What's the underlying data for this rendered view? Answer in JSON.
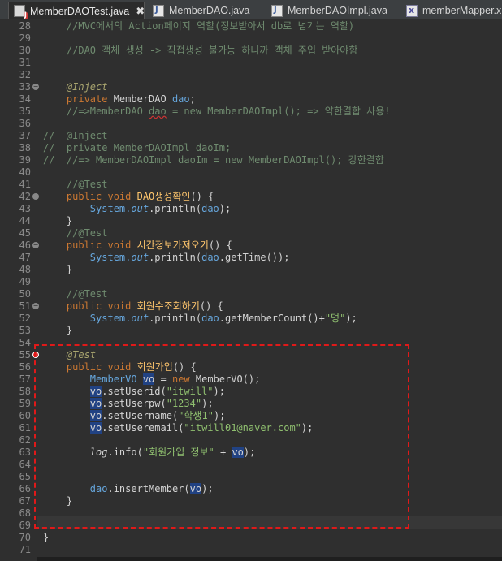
{
  "tabs": [
    {
      "label": "MemberDAOTest.java",
      "icon": "java-test-file-icon",
      "active": true,
      "close": "✖"
    },
    {
      "label": "MemberDAO.java",
      "icon": "java-file-icon",
      "active": false
    },
    {
      "label": "MemberDAOImpl.java",
      "icon": "java-file-icon",
      "active": false
    },
    {
      "label": "memberMapper.xm",
      "icon": "xml-file-icon",
      "active": false
    }
  ],
  "lines": [
    {
      "n": "28",
      "segs": [
        [
          "cm",
          "    //MVC에서의 Action페이지 역할(정보받아서 db로 넘기는 역할)"
        ]
      ]
    },
    {
      "n": "29",
      "segs": []
    },
    {
      "n": "30",
      "segs": [
        [
          "cm",
          "    //DAO 객체 생성 -> 직접생성 불가능 하니까 객체 주입 받아야함"
        ]
      ]
    },
    {
      "n": "31",
      "segs": []
    },
    {
      "n": "32",
      "segs": []
    },
    {
      "n": "33",
      "fold": true,
      "segs": [
        [
          "an",
          "    @Inject"
        ]
      ]
    },
    {
      "n": "34",
      "segs": [
        [
          "kw",
          "    private "
        ],
        [
          "txt",
          "MemberDAO "
        ],
        [
          "fld",
          "dao"
        ],
        [
          "txt",
          ";"
        ]
      ]
    },
    {
      "n": "35",
      "segs": [
        [
          "cm",
          "    //=>MemberDAO "
        ],
        [
          "cmsq",
          "dao"
        ],
        [
          "cm",
          " = new MemberDAOImpl(); => 약한결합 사용!"
        ]
      ]
    },
    {
      "n": "36",
      "segs": []
    },
    {
      "n": "37",
      "segs": [
        [
          "cm",
          "//  @Inject"
        ]
      ]
    },
    {
      "n": "38",
      "segs": [
        [
          "cm",
          "//  private MemberDAOImpl daoIm;"
        ]
      ]
    },
    {
      "n": "39",
      "segs": [
        [
          "cm",
          "//  //=> MemberDAOImpl daoIm = new MemberDAOImpl(); 강한결합"
        ]
      ]
    },
    {
      "n": "40",
      "segs": []
    },
    {
      "n": "41",
      "segs": [
        [
          "cm",
          "    //@Test"
        ]
      ]
    },
    {
      "n": "42",
      "fold": true,
      "segs": [
        [
          "kw",
          "    public void "
        ],
        [
          "fn",
          "DAO생성확인"
        ],
        [
          "txt",
          "() {"
        ]
      ]
    },
    {
      "n": "43",
      "segs": [
        [
          "txt",
          "        "
        ],
        [
          "fld",
          "System."
        ],
        [
          "sf",
          "out"
        ],
        [
          "txt",
          ".println("
        ],
        [
          "fld",
          "dao"
        ],
        [
          "txt",
          ");"
        ]
      ]
    },
    {
      "n": "44",
      "segs": [
        [
          "txt",
          "    }"
        ]
      ]
    },
    {
      "n": "45",
      "segs": [
        [
          "cm",
          "    //@Test"
        ]
      ]
    },
    {
      "n": "46",
      "fold": true,
      "segs": [
        [
          "kw",
          "    public void "
        ],
        [
          "fn",
          "시간정보가져오기"
        ],
        [
          "txt",
          "() {"
        ]
      ]
    },
    {
      "n": "47",
      "segs": [
        [
          "txt",
          "        "
        ],
        [
          "fld",
          "System."
        ],
        [
          "sf",
          "out"
        ],
        [
          "txt",
          ".println("
        ],
        [
          "fld",
          "dao"
        ],
        [
          "txt",
          ".getTime());"
        ]
      ]
    },
    {
      "n": "48",
      "segs": [
        [
          "txt",
          "    }"
        ]
      ]
    },
    {
      "n": "49",
      "segs": []
    },
    {
      "n": "50",
      "segs": [
        [
          "cm",
          "    //@Test"
        ]
      ]
    },
    {
      "n": "51",
      "fold": true,
      "segs": [
        [
          "kw",
          "    public void "
        ],
        [
          "fn",
          "회원수조회하기"
        ],
        [
          "txt",
          "() {"
        ]
      ]
    },
    {
      "n": "52",
      "segs": [
        [
          "txt",
          "        "
        ],
        [
          "fld",
          "System."
        ],
        [
          "sf",
          "out"
        ],
        [
          "txt",
          ".println("
        ],
        [
          "fld",
          "dao"
        ],
        [
          "txt",
          ".getMemberCount()+"
        ],
        [
          "str",
          "\"명\""
        ],
        [
          "txt",
          ");"
        ]
      ]
    },
    {
      "n": "53",
      "segs": [
        [
          "txt",
          "    }"
        ]
      ]
    },
    {
      "n": "54",
      "segs": []
    },
    {
      "n": "55",
      "err": true,
      "segs": [
        [
          "an",
          "    @Test"
        ]
      ]
    },
    {
      "n": "56",
      "segs": [
        [
          "kw",
          "    public void "
        ],
        [
          "fn",
          "회원가입"
        ],
        [
          "txt",
          "() {"
        ]
      ]
    },
    {
      "n": "57",
      "segs": [
        [
          "txt",
          "        "
        ],
        [
          "fld",
          "MemberVO "
        ],
        [
          "hv",
          "vo"
        ],
        [
          "txt",
          " = "
        ],
        [
          "kw",
          "new "
        ],
        [
          "txt",
          "MemberVO();"
        ]
      ]
    },
    {
      "n": "58",
      "segs": [
        [
          "txt",
          "        "
        ],
        [
          "hv",
          "vo"
        ],
        [
          "txt",
          ".setUserid("
        ],
        [
          "str",
          "\"itwill\""
        ],
        [
          "txt",
          ");"
        ]
      ]
    },
    {
      "n": "59",
      "segs": [
        [
          "txt",
          "        "
        ],
        [
          "hv",
          "vo"
        ],
        [
          "txt",
          ".setUserpw("
        ],
        [
          "str",
          "\"1234\""
        ],
        [
          "txt",
          ");"
        ]
      ]
    },
    {
      "n": "60",
      "segs": [
        [
          "txt",
          "        "
        ],
        [
          "hv",
          "vo"
        ],
        [
          "txt",
          ".setUsername("
        ],
        [
          "str",
          "\"학생1\""
        ],
        [
          "txt",
          ");"
        ]
      ]
    },
    {
      "n": "61",
      "segs": [
        [
          "txt",
          "        "
        ],
        [
          "hv",
          "vo"
        ],
        [
          "txt",
          ".setUseremail("
        ],
        [
          "str",
          "\"itwill01@naver.com\""
        ],
        [
          "txt",
          ");"
        ]
      ]
    },
    {
      "n": "62",
      "segs": []
    },
    {
      "n": "63",
      "segs": [
        [
          "txt",
          "        "
        ],
        [
          "itl",
          "log"
        ],
        [
          "txt",
          ".info("
        ],
        [
          "str",
          "\"회원가입 정보\""
        ],
        [
          "txt",
          " + "
        ],
        [
          "hv",
          "vo"
        ],
        [
          "txt",
          ");"
        ]
      ]
    },
    {
      "n": "64",
      "segs": []
    },
    {
      "n": "65",
      "segs": []
    },
    {
      "n": "66",
      "segs": [
        [
          "txt",
          "        "
        ],
        [
          "fld",
          "dao"
        ],
        [
          "txt",
          ".insertMember("
        ],
        [
          "hv",
          "vo"
        ],
        [
          "txt",
          ");"
        ]
      ]
    },
    {
      "n": "67",
      "segs": [
        [
          "txt",
          "    }"
        ]
      ]
    },
    {
      "n": "68",
      "segs": []
    },
    {
      "n": "69",
      "segs": []
    },
    {
      "n": "70",
      "segs": [
        [
          "txt",
          "}"
        ]
      ]
    },
    {
      "n": "71",
      "segs": []
    }
  ],
  "current_line": "69"
}
